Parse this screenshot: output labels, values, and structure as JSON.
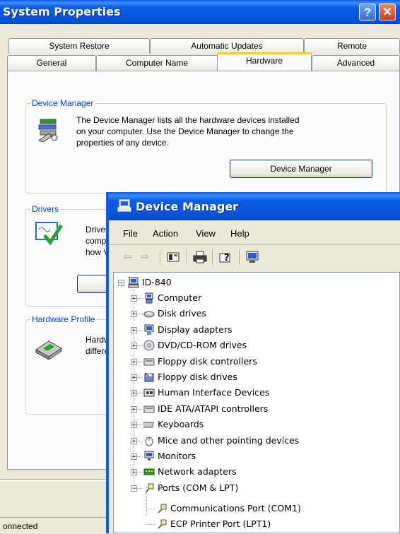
{
  "system_properties": {
    "title": "System Properties",
    "help_glyph": "?",
    "close_glyph": "✕",
    "tabs_top": [
      "System Restore",
      "Automatic Updates",
      "Remote"
    ],
    "tabs_bottom": [
      "General",
      "Computer Name",
      "Hardware",
      "Advanced"
    ],
    "active_tab": "Hardware",
    "device_manager_group": {
      "label": "Device Manager",
      "text_lines": [
        "The Device Manager lists all the hardware devices installed",
        "on your computer. Use the Device Manager to change the",
        "properties of any device."
      ],
      "button": "Device Manager"
    },
    "drivers_group": {
      "label": "Drivers",
      "text_lines": [
        "Driver",
        "comp",
        "how V"
      ]
    },
    "hardware_profiles_group": {
      "label": "Hardware Profile",
      "text_lines": [
        "Hardw",
        "differe"
      ]
    },
    "status_text": "onnected"
  },
  "device_manager": {
    "title": "Device Manager",
    "menu": [
      "File",
      "Action",
      "View",
      "Help"
    ],
    "tree_root": "ID-840",
    "tree_items": [
      {
        "label": "Computer",
        "icon": "computer-icon",
        "expanded": false
      },
      {
        "label": "Disk drives",
        "icon": "disk-drive-icon",
        "expanded": false
      },
      {
        "label": "Display adapters",
        "icon": "display-adapter-icon",
        "expanded": false
      },
      {
        "label": "DVD/CD-ROM drives",
        "icon": "cdrom-icon",
        "expanded": false
      },
      {
        "label": "Floppy disk controllers",
        "icon": "controller-icon",
        "expanded": false
      },
      {
        "label": "Floppy disk drives",
        "icon": "floppy-icon",
        "expanded": false
      },
      {
        "label": "Human Interface Devices",
        "icon": "hid-icon",
        "expanded": false
      },
      {
        "label": "IDE ATA/ATAPI controllers",
        "icon": "controller-icon",
        "expanded": false
      },
      {
        "label": "Keyboards",
        "icon": "keyboard-icon",
        "expanded": false
      },
      {
        "label": "Mice and other pointing devices",
        "icon": "mouse-icon",
        "expanded": false
      },
      {
        "label": "Monitors",
        "icon": "monitor-icon",
        "expanded": false
      },
      {
        "label": "Network adapters",
        "icon": "network-adapter-icon",
        "expanded": false
      },
      {
        "label": "Ports (COM & LPT)",
        "icon": "port-icon",
        "expanded": true
      }
    ],
    "port_children": [
      "Communications Port (COM1)",
      "ECP Printer Port (LPT1)"
    ]
  },
  "colors": {
    "title_blue": "#0a5ce9",
    "group_label": "#0046d5",
    "active_tab_accent": "#ffc83c"
  }
}
